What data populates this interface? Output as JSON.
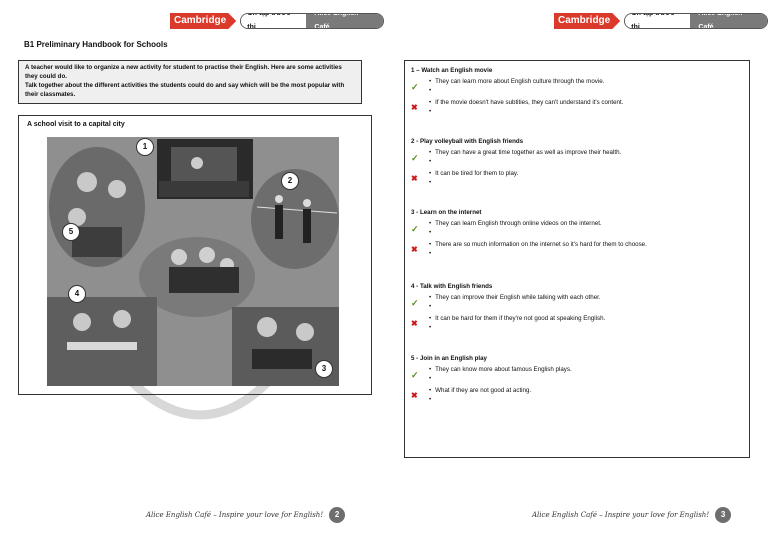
{
  "header": {
    "brand": "Cambridge",
    "tag_a": "Ôn tập trước thi",
    "tag_b": "Alice English Café"
  },
  "left": {
    "handbook_title": "B1 Preliminary Handbook for Schools",
    "task_line1": "A teacher would like to organize a new activity for student to practise their English. Here are some activities they could do.",
    "task_line2": "Talk together about the different activities the students could do and say which will be the most popular with their classmates.",
    "visit_title": "A school visit to a capital city",
    "markers": [
      "1",
      "2",
      "3",
      "4",
      "5"
    ],
    "footer": "Alice English Café – Inspire your love for English!",
    "page": "2"
  },
  "right": {
    "topics": [
      {
        "title": "1 – Watch an English movie",
        "pro": [
          "They can learn more about English culture through the movie.",
          ""
        ],
        "con": [
          "If the movie doesn't have subtities, they can't understand it's content.",
          ""
        ]
      },
      {
        "title": "2 - Play volleyball with English friends",
        "pro": [
          "They can have a great time together as well as improve their health.",
          ""
        ],
        "con": [
          "It can be tired for them to play.",
          ""
        ]
      },
      {
        "title": "3 - Learn on the internet",
        "pro": [
          "They can learn English through online videos on the internet.",
          ""
        ],
        "con": [
          "There are so much information on the internet so it's hard for them to choose.",
          ""
        ]
      },
      {
        "title": "4 - Talk with English friends",
        "pro": [
          "They can improve their English while talking with each other.",
          ""
        ],
        "con": [
          "It can be hard for them if they're not good at speaking English.",
          ""
        ]
      },
      {
        "title": "5 - Join in an English play",
        "pro": [
          "They can know more about famous English plays.",
          ""
        ],
        "con": [
          "What if they are not good at acting.",
          ""
        ]
      }
    ],
    "footer": "Alice English Café – Inspire your love for English!",
    "page": "3"
  }
}
